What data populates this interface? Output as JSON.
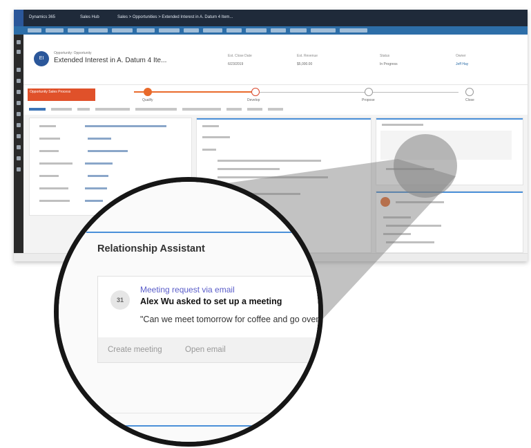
{
  "app": {
    "title": "Dynamics 365",
    "area": "Sales Hub",
    "breadcrumb": "Sales > Opportunities > Extended Interest in A. Datum 4 Item..."
  },
  "record": {
    "initials": "EI",
    "entity": "Opportunity: Opportunity",
    "title": "Extended Interest in A. Datum 4 Ite..."
  },
  "header_fields": [
    {
      "label": "Est. Close Date",
      "value": "6/23/2019"
    },
    {
      "label": "Est. Revenue",
      "value": "$5,000.00"
    },
    {
      "label": "Status",
      "value": "In Progress"
    },
    {
      "label": "Owner",
      "value": "Jeff Hay"
    }
  ],
  "bpf": {
    "alert": "Opportunity Sales Process",
    "stages": [
      "Qualify",
      "Develop",
      "Propose",
      "Close"
    ]
  },
  "relationship_assistant": {
    "title": "Relationship Assistant",
    "card": {
      "icon_initials": "31",
      "link": "Meeting request via email",
      "headline": "Alex Wu asked to set up a meeting",
      "quote": "\"Can we meet tomorrow for coffee and go over the proposal?\""
    },
    "actions": {
      "create_meeting": "Create meeting",
      "open_email": "Open email"
    }
  },
  "colors": {
    "topbar": "#1f2a3a",
    "command_bar": "#2d6ea8",
    "accent_blue": "#4a90d9",
    "bpf_orange": "#e96a2b",
    "link_purple": "#5a5dc9",
    "lens_border": "#161616"
  },
  "icons": [
    "waffle-icon",
    "meeting-icon",
    "avatar-icon"
  ]
}
